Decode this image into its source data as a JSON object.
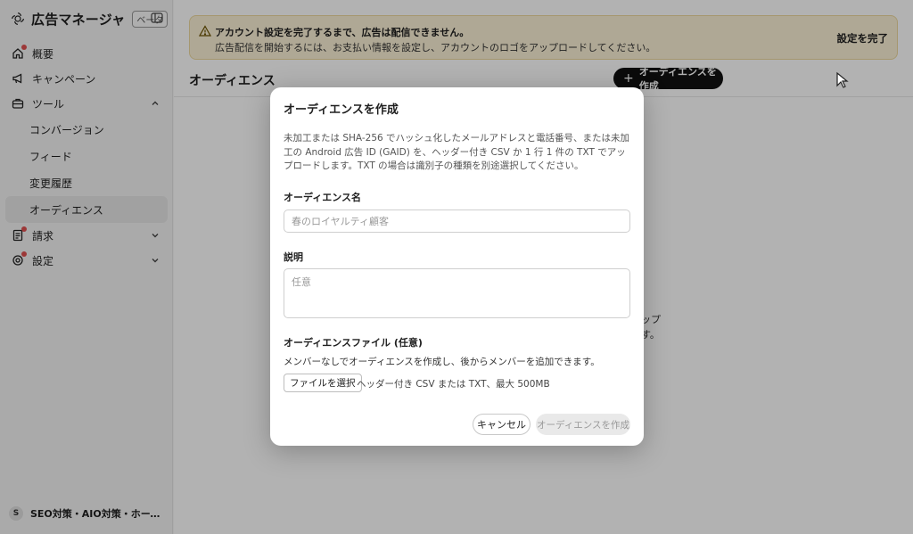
{
  "app": {
    "title": "広告マネージャ",
    "beta_badge": "ベータ"
  },
  "sidebar": {
    "items": [
      {
        "label": "概要",
        "icon": "home-icon",
        "badge": true
      },
      {
        "label": "キャンペーン",
        "icon": "megaphone-icon",
        "badge": false
      },
      {
        "label": "ツール",
        "icon": "toolbox-icon",
        "badge": false,
        "expanded": true
      },
      {
        "label": "請求",
        "icon": "receipt-icon",
        "badge": true,
        "expanded": false
      },
      {
        "label": "設定",
        "icon": "gear-icon",
        "badge": true,
        "expanded": false
      }
    ],
    "tools_subitems": [
      {
        "label": "コンバージョン"
      },
      {
        "label": "フィード"
      },
      {
        "label": "変更履歴"
      },
      {
        "label": "オーディエンス",
        "active": true
      }
    ],
    "account": {
      "initial": "S",
      "name": "SEO対策・AIO対策・ホームページ..."
    }
  },
  "banner": {
    "title": "アカウント設定を完了するまで、広告は配信できません。",
    "message": "広告配信を開始するには、お支払い情報を設定し、アカウントのロゴをアップロードしてください。",
    "action": "設定を完了"
  },
  "page": {
    "title": "オーディエンス",
    "create_button": "オーディエンスを作成",
    "background_text_line1": "ップ",
    "background_text_line2": "す。"
  },
  "modal": {
    "title": "オーディエンスを作成",
    "description": "未加工または SHA-256 でハッシュ化したメールアドレスと電話番号、または未加工の Android 広告 ID (GAID) を、ヘッダー付き CSV か 1 行 1 件の TXT でアップロードします。TXT の場合は識別子の種類を別途選択してください。",
    "name_label": "オーディエンス名",
    "name_placeholder": "春のロイヤルティ顧客",
    "description_label": "説明",
    "description_placeholder": "任意",
    "file_label": "オーディエンスファイル (任意)",
    "file_hint": "メンバーなしでオーディエンスを作成し、後からメンバーを追加できます。",
    "file_button": "ファイルを選択",
    "file_status": "ヘッダー付き CSV または TXT、最大 500MB",
    "cancel_button": "キャンセル",
    "submit_button": "オーディエンスを作成"
  },
  "colors": {
    "banner_bg": "#fbf1d6",
    "primary_button": "#111111",
    "badge_dot": "#e05050"
  }
}
